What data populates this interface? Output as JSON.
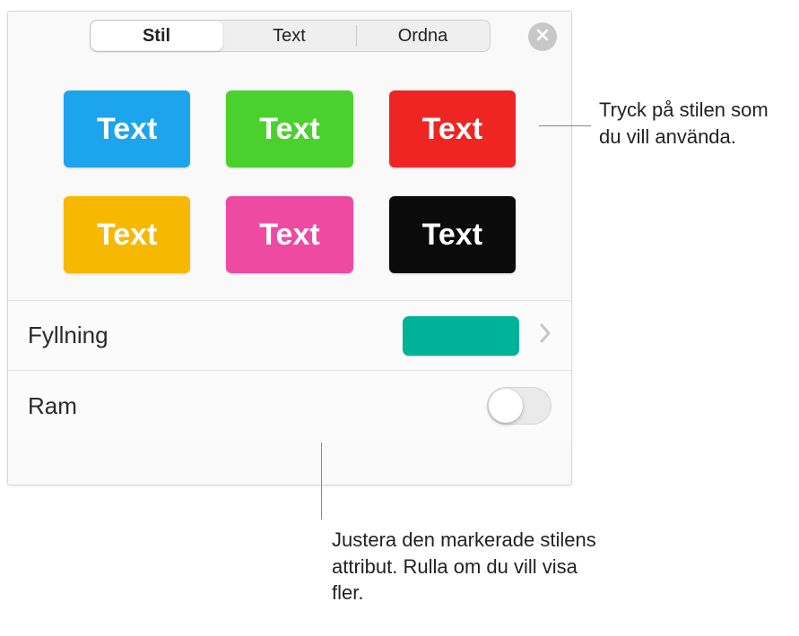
{
  "tabs": {
    "stil": "Stil",
    "text": "Text",
    "ordna": "Ordna"
  },
  "swatches": [
    {
      "label": "Text",
      "color": "#1ca4ec"
    },
    {
      "label": "Text",
      "color": "#4bd12e"
    },
    {
      "label": "Text",
      "color": "#ee2523"
    },
    {
      "label": "Text",
      "color": "#f7b900"
    },
    {
      "label": "Text",
      "color": "#ee4aa2"
    },
    {
      "label": "Text",
      "color": "#0b0b0b"
    }
  ],
  "fill": {
    "label": "Fyllning",
    "color": "#00b29a"
  },
  "frame": {
    "label": "Ram",
    "enabled": false
  },
  "callouts": {
    "top": "Tryck på stilen som du vill använda.",
    "bottom": "Justera den markerade stilens attribut. Rulla om du vill visa fler."
  }
}
